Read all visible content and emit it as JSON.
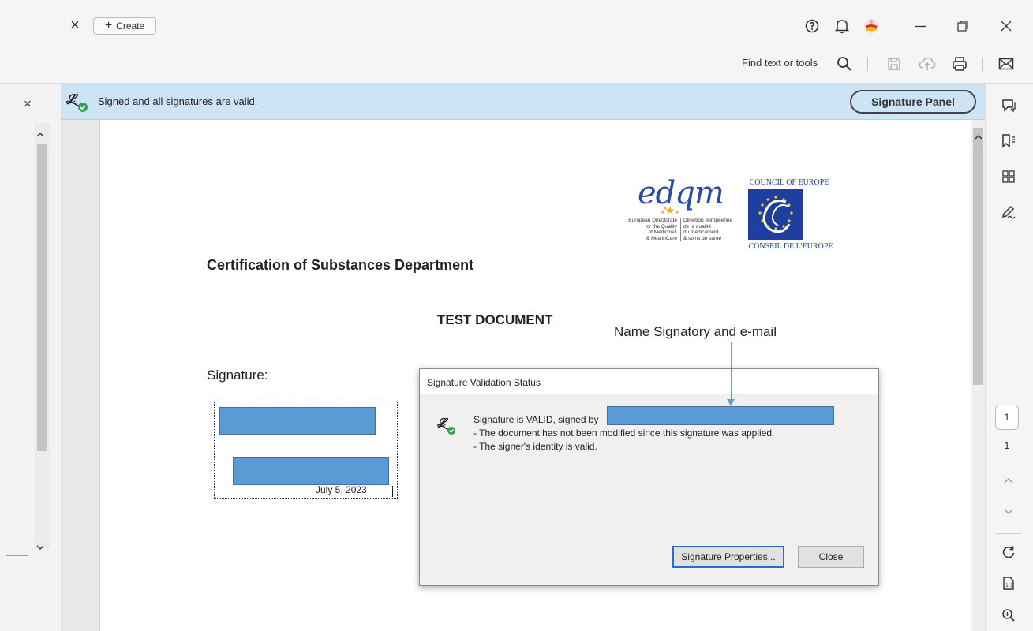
{
  "titlebar": {
    "tab_close_glyph": "×",
    "create_icon": "+",
    "create_label": "Create"
  },
  "toolbar": {
    "find_text": "Find text or tools"
  },
  "banner": {
    "status_text": "Signed and all signatures are valid.",
    "signature_panel_label": "Signature Panel"
  },
  "left_strip": {
    "close_glyph": "×"
  },
  "document": {
    "logo_edqm_word": "edqm",
    "logo_edqm_en": [
      "European Directorate",
      "for the Quality",
      "of Medicines",
      "& HealthCare"
    ],
    "logo_edqm_fr": [
      "Direction européenne",
      "de la qualité",
      "du médicament",
      "& soins de santé"
    ],
    "logo_coe_top": "COUNCIL OF EUROPE",
    "logo_coe_bottom": "CONSEIL DE L'EUROPE",
    "department": "Certification of Substances Department",
    "title": "TEST DOCUMENT",
    "annotation": "Name Signatory and e-mail",
    "signature_label": "Signature:",
    "signature_date": "July 5, 2023"
  },
  "dialog": {
    "title": "Signature Validation Status",
    "line1": "Signature is VALID, signed by",
    "line2": "- The document has not been modified since this signature was applied.",
    "line3": "- The signer's identity is valid.",
    "properties_button": "Signature Properties...",
    "close_button": "Close"
  },
  "page_nav": {
    "current_page": "1",
    "total_pages": "1"
  },
  "colors": {
    "banner_bg": "#cde4f7",
    "redaction": "#5b9bd5",
    "valid_green": "#2ea44f",
    "annotation_arrow": "#6b9bd0"
  }
}
